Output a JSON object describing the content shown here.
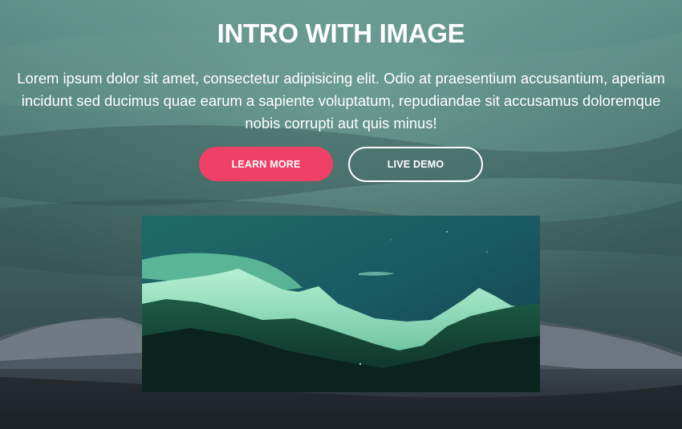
{
  "hero": {
    "title": "INTRO WITH IMAGE",
    "description": "Lorem ipsum dolor sit amet, consectetur adipisicing elit. Odio at praesentium accusantium, aperiam incidunt sed ducimus quae earum a sapiente voluptatum, repudiandae sit accusamus doloremque nobis corrupti aut quis minus!",
    "primary_button_label": "LEARN MORE",
    "secondary_button_label": "LIVE DEMO"
  },
  "colors": {
    "primary_button": "#ef4066",
    "text": "#ffffff",
    "background_tint": "#3c5a59"
  },
  "images": {
    "background": "cloudy-mountain-landscape",
    "feature_image": "green-tinted-mountain-range"
  }
}
